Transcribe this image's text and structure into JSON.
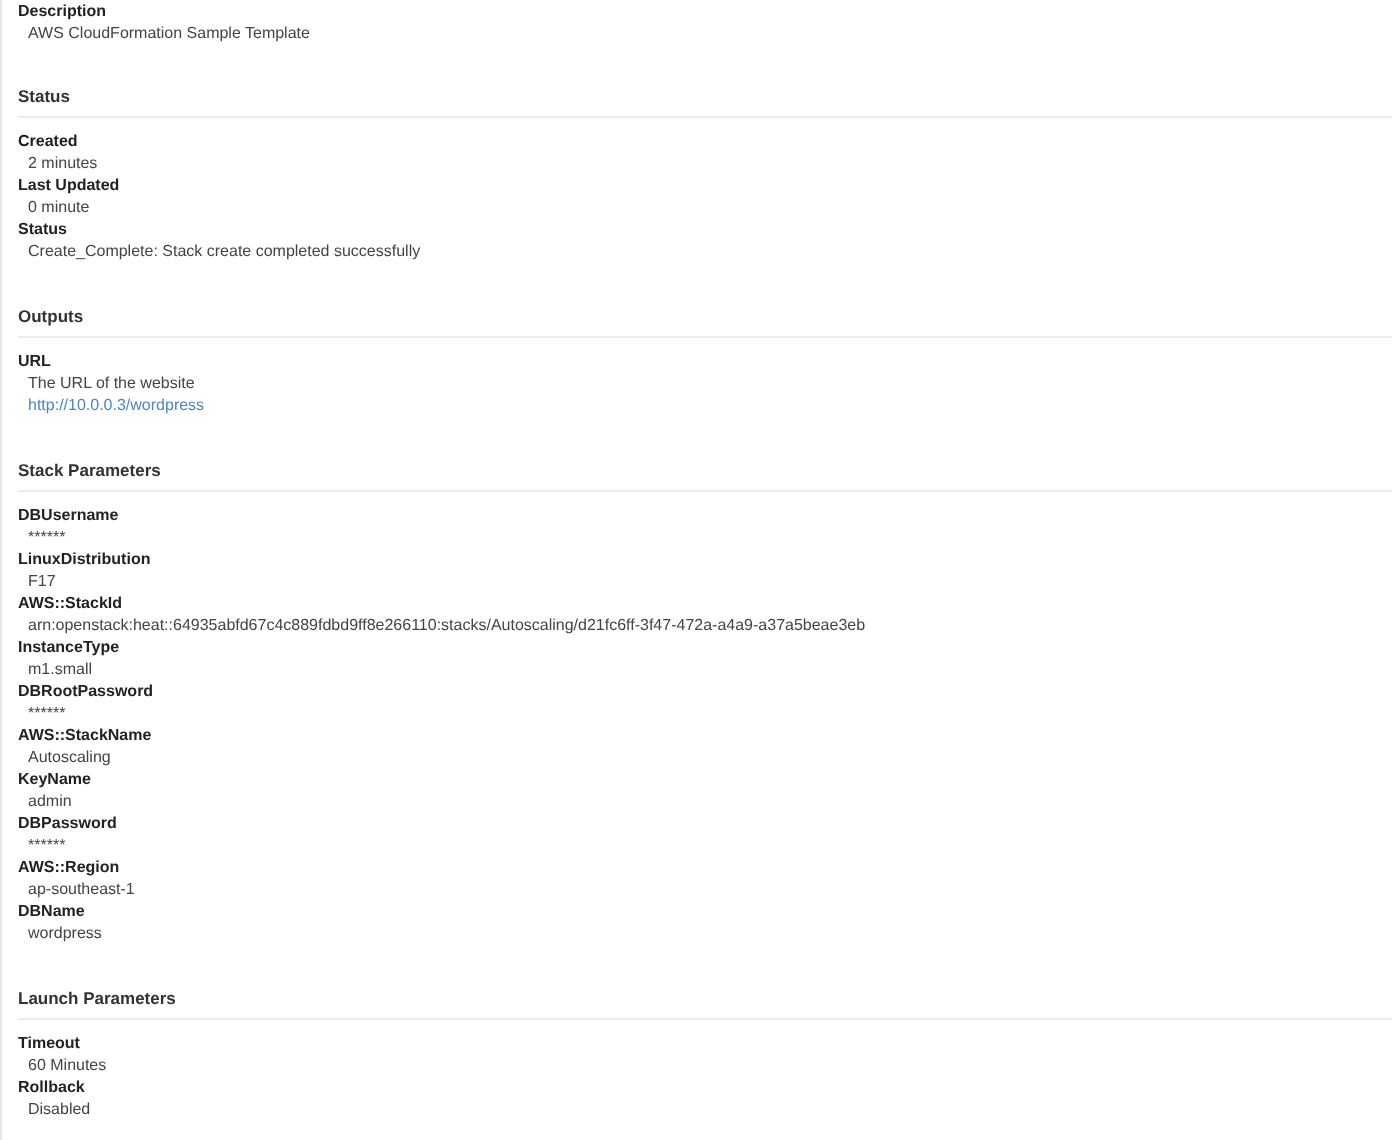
{
  "overview": [
    {
      "label": "Description",
      "values": [
        {
          "kind": "text",
          "text": "AWS CloudFormation Sample Template"
        }
      ]
    }
  ],
  "sections": [
    {
      "heading": "Status",
      "items": [
        {
          "label": "Created",
          "values": [
            {
              "kind": "text",
              "text": "2 minutes"
            }
          ]
        },
        {
          "label": "Last Updated",
          "values": [
            {
              "kind": "text",
              "text": "0 minute"
            }
          ]
        },
        {
          "label": "Status",
          "values": [
            {
              "kind": "text",
              "text": "Create_Complete: Stack create completed successfully"
            }
          ]
        }
      ]
    },
    {
      "heading": "Outputs",
      "items": [
        {
          "label": "URL",
          "values": [
            {
              "kind": "text",
              "text": "The URL of the website"
            },
            {
              "kind": "link",
              "text": "http://10.0.0.3/wordpress"
            }
          ]
        }
      ]
    },
    {
      "heading": "Stack Parameters",
      "items": [
        {
          "label": "DBUsername",
          "values": [
            {
              "kind": "text",
              "text": "******"
            }
          ]
        },
        {
          "label": "LinuxDistribution",
          "values": [
            {
              "kind": "text",
              "text": "F17"
            }
          ]
        },
        {
          "label": "AWS::StackId",
          "values": [
            {
              "kind": "text",
              "text": "arn:openstack:heat::64935abfd67c4c889fdbd9ff8e266110:stacks/Autoscaling/d21fc6ff-3f47-472a-a4a9-a37a5beae3eb"
            }
          ]
        },
        {
          "label": "InstanceType",
          "values": [
            {
              "kind": "text",
              "text": "m1.small"
            }
          ]
        },
        {
          "label": "DBRootPassword",
          "values": [
            {
              "kind": "text",
              "text": "******"
            }
          ]
        },
        {
          "label": "AWS::StackName",
          "values": [
            {
              "kind": "text",
              "text": "Autoscaling"
            }
          ]
        },
        {
          "label": "KeyName",
          "values": [
            {
              "kind": "text",
              "text": "admin"
            }
          ]
        },
        {
          "label": "DBPassword",
          "values": [
            {
              "kind": "text",
              "text": "******"
            }
          ]
        },
        {
          "label": "AWS::Region",
          "values": [
            {
              "kind": "text",
              "text": "ap-southeast-1"
            }
          ]
        },
        {
          "label": "DBName",
          "values": [
            {
              "kind": "text",
              "text": "wordpress"
            }
          ]
        }
      ]
    },
    {
      "heading": "Launch Parameters",
      "items": [
        {
          "label": "Timeout",
          "values": [
            {
              "kind": "text",
              "text": "60 Minutes"
            }
          ]
        },
        {
          "label": "Rollback",
          "values": [
            {
              "kind": "text",
              "text": "Disabled"
            }
          ]
        }
      ]
    }
  ]
}
